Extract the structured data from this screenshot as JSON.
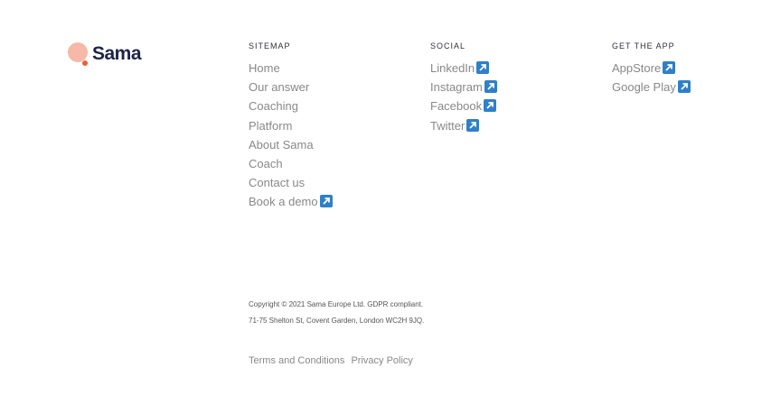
{
  "brand": {
    "name": "Sama"
  },
  "sitemap": {
    "title": "SITEMAP",
    "items": [
      {
        "label": "Home"
      },
      {
        "label": "Our answer"
      },
      {
        "label": "Coaching"
      },
      {
        "label": "Platform"
      },
      {
        "label": "About Sama"
      },
      {
        "label": "Coach"
      },
      {
        "label": "Contact us"
      },
      {
        "label": "Book a demo",
        "icon": "external-link-icon"
      }
    ]
  },
  "social": {
    "title": "SOCIAL",
    "items": [
      {
        "label": "LinkedIn",
        "icon": "external-link-icon"
      },
      {
        "label": "Instagram",
        "icon": "external-link-icon"
      },
      {
        "label": "Facebook",
        "icon": "external-link-icon"
      },
      {
        "label": "Twitter",
        "icon": "external-link-icon"
      }
    ]
  },
  "app": {
    "title": "GET THE APP",
    "items": [
      {
        "label": "AppStore",
        "icon": "external-link-icon"
      },
      {
        "label": "Google Play",
        "icon": "external-link-icon"
      }
    ]
  },
  "legal": {
    "copyright": "Copyright © 2021 Sama Europe Ltd. GDPR compliant.",
    "address": "71-75 Shelton St, Covent Garden, London WC2H 9JQ."
  },
  "bottom_links": {
    "terms": "Terms and Conditions",
    "privacy": "Privacy Policy"
  },
  "colors": {
    "brand_navy": "#1d2448",
    "brand_peach": "#f6b9a8",
    "brand_orange": "#ef5a3c",
    "link_gray": "#888888",
    "external_icon_blue": "#2f7fc9"
  }
}
